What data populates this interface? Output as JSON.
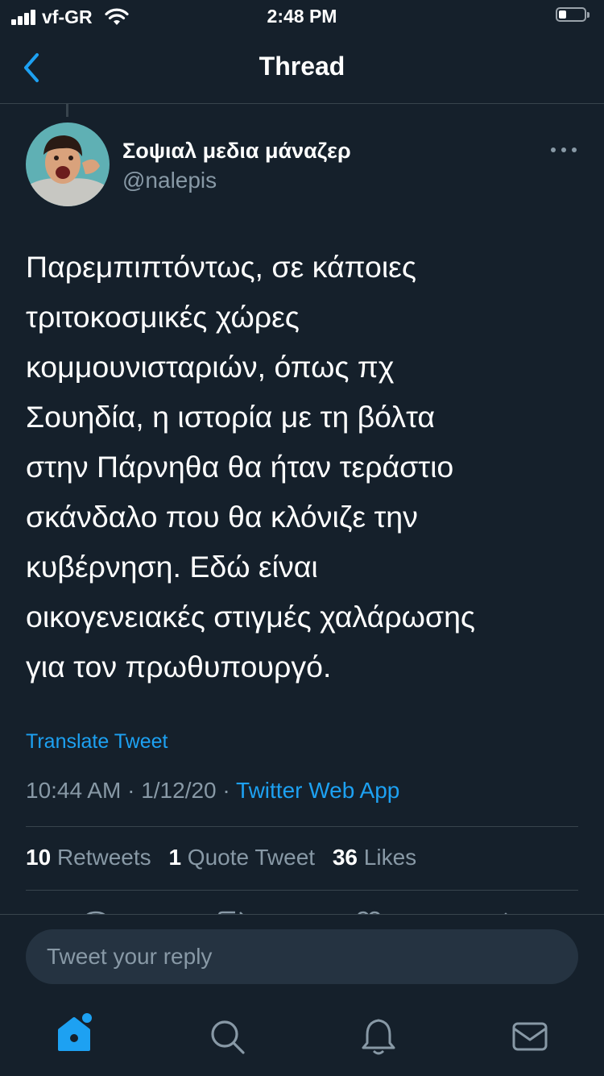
{
  "status_bar": {
    "carrier": "vf-GR",
    "time": "2:48 PM"
  },
  "header": {
    "title": "Thread",
    "back_icon": "chevron-left-icon"
  },
  "tweet": {
    "author_name": "Σοψιαλ μεδια μάναζερ",
    "author_handle": "@nalepis",
    "lines": [
      "Παρεμπιπτόντως, σε κάποιες",
      "τριτοκοσμικές χώρες",
      "κομμουνισταριών, όπως πχ",
      "Σουηδία, η ιστορία με τη βόλτα",
      "στην Πάρνηθα θα ήταν τεράστιο",
      "σκάνδαλο που θα κλόνιζε την",
      "κυβέρνηση. Εδώ είναι",
      "οικογενειακές στιγμές χαλάρωσης",
      "για τον πρωθυπουργό."
    ],
    "translate_label": "Translate Tweet",
    "time": "10:44 AM",
    "date": "1/12/20",
    "separator": "·",
    "source": "Twitter Web App"
  },
  "stats": {
    "retweets_count": "10",
    "retweets_label": "Retweets",
    "quotes_count": "1",
    "quotes_label": "Quote Tweet",
    "likes_count": "36",
    "likes_label": "Likes"
  },
  "reply": {
    "placeholder": "Tweet your reply"
  },
  "tab_bar": {
    "items": [
      "home-icon",
      "search-icon",
      "notifications-icon",
      "messages-icon"
    ],
    "active_color": "#1da1f2",
    "inactive_color": "#8899a6"
  },
  "colors": {
    "background": "#15202b",
    "accent": "#1da1f2",
    "muted": "#8899a6",
    "divider": "#38444d"
  }
}
